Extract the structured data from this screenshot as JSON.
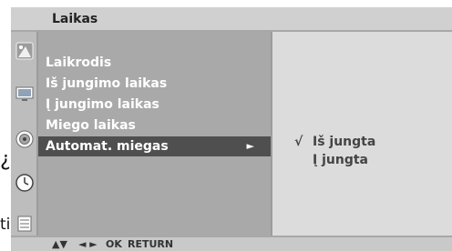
{
  "stray_text": [
    "¿",
    "ti"
  ],
  "osd": {
    "title": "Laikas",
    "icons": [
      "picture-icon",
      "screen-icon",
      "audio-icon",
      "clock-icon",
      "settings-icon"
    ],
    "menu_items": [
      {
        "label": "Laikrodis"
      },
      {
        "label": "Iš jungimo laikas"
      },
      {
        "label": "Į jungimo laikas"
      },
      {
        "label": "Miego laikas"
      },
      {
        "label": "Automat. miegas",
        "selected": true,
        "arrow": "►"
      }
    ],
    "submenu": {
      "check": "√",
      "options": [
        "Iš jungta",
        "Į jungta"
      ]
    },
    "hints": {
      "updown": "▲▼",
      "leftright": "◄ ►",
      "ok": "OK",
      "return": "RETURN"
    },
    "colors": {
      "background": "#e5e5e5",
      "menu": "#a9a9a9",
      "selected": "#4f4f4f",
      "submenu": "#dcdcdc"
    }
  }
}
